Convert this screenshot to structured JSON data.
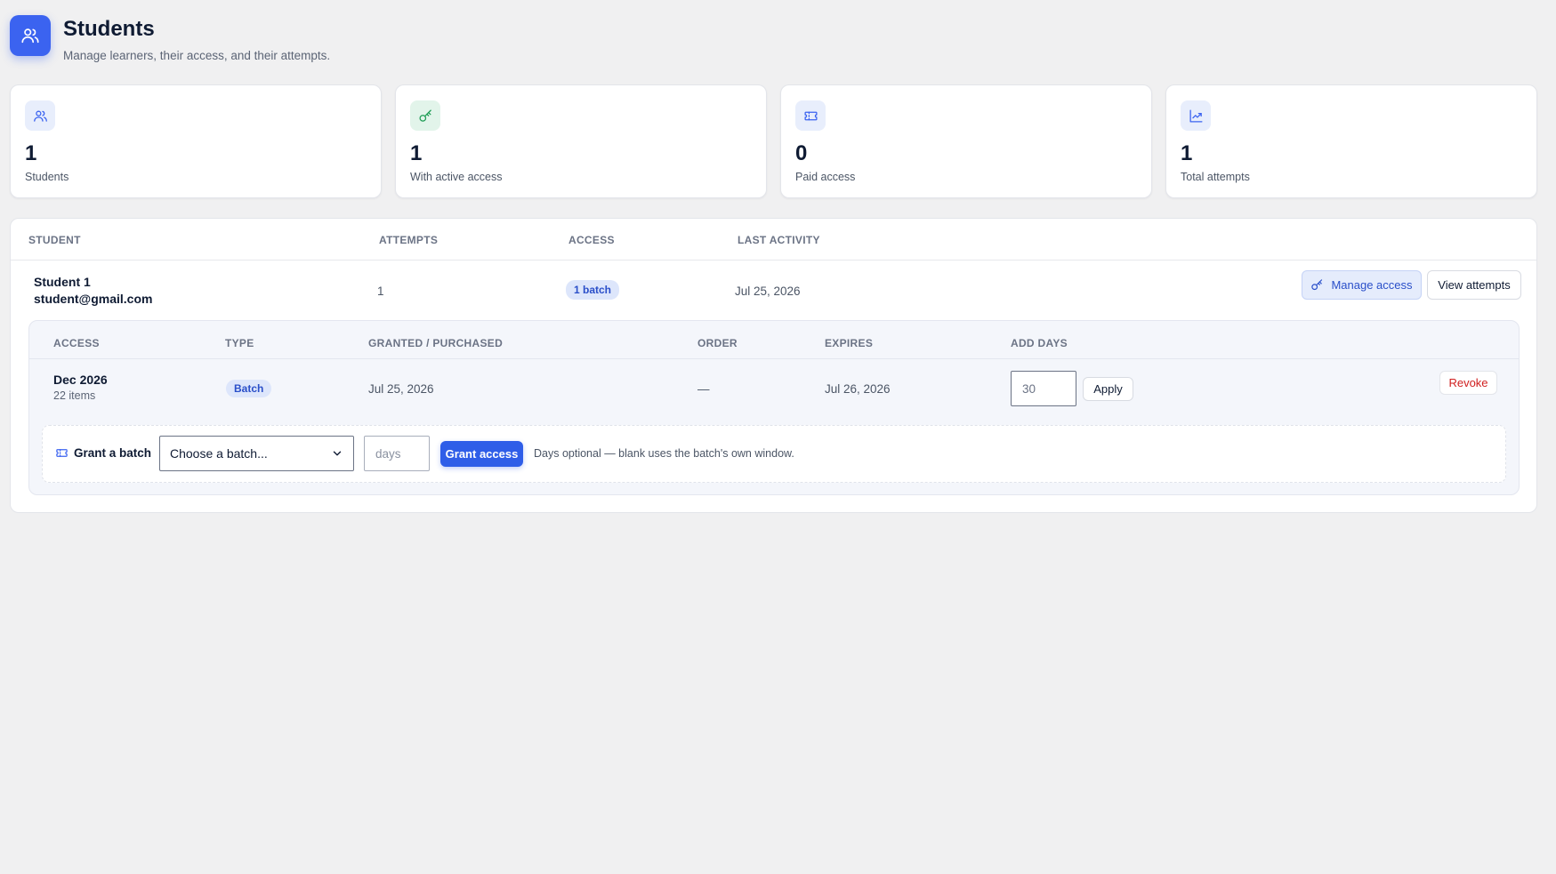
{
  "header": {
    "title": "Students",
    "subtitle": "Manage learners, their access, and their attempts.",
    "icon": "users-icon"
  },
  "stats": [
    {
      "value": "1",
      "label": "Students",
      "icon": "users-icon",
      "icon_color": "#3b63f0"
    },
    {
      "value": "1",
      "label": "With active access",
      "icon": "key-icon",
      "icon_color": "#1f9d55"
    },
    {
      "value": "0",
      "label": "Paid access",
      "icon": "ticket-icon",
      "icon_color": "#3b63f0"
    },
    {
      "value": "1",
      "label": "Total attempts",
      "icon": "trending-up-icon",
      "icon_color": "#3b63f0"
    }
  ],
  "table": {
    "columns": [
      "STUDENT",
      "ATTEMPTS",
      "ACCESS",
      "LAST ACTIVITY"
    ],
    "rows": [
      {
        "name": "Student 1",
        "email": "student@gmail.com",
        "attempts": "1",
        "access": "1 batch",
        "last_activity": "Jul 25, 2026",
        "manage_label": "Manage access",
        "view_label": "View attempts"
      }
    ]
  },
  "access_panel": {
    "columns": [
      "ACCESS",
      "TYPE",
      "GRANTED / PURCHASED",
      "ORDER",
      "EXPIRES",
      "ADD DAYS"
    ],
    "rows": [
      {
        "name": "Dec 2026",
        "items": "22 items",
        "type": "Batch",
        "granted": "Jul 25, 2026",
        "order": "—",
        "expires": "Jul 26, 2026",
        "add_days": "30",
        "apply_label": "Apply",
        "revoke_label": "Revoke"
      }
    ],
    "grant": {
      "label": "Grant a batch",
      "select_value": "Choose a batch...",
      "days_placeholder": "days",
      "button_label": "Grant access",
      "hint": "Days optional — blank uses the batch's own window."
    }
  },
  "colors": {
    "accent": "#3b63f0",
    "primary_button": "#2f5ee8",
    "danger": "#d02020",
    "success": "#1f9d55"
  }
}
